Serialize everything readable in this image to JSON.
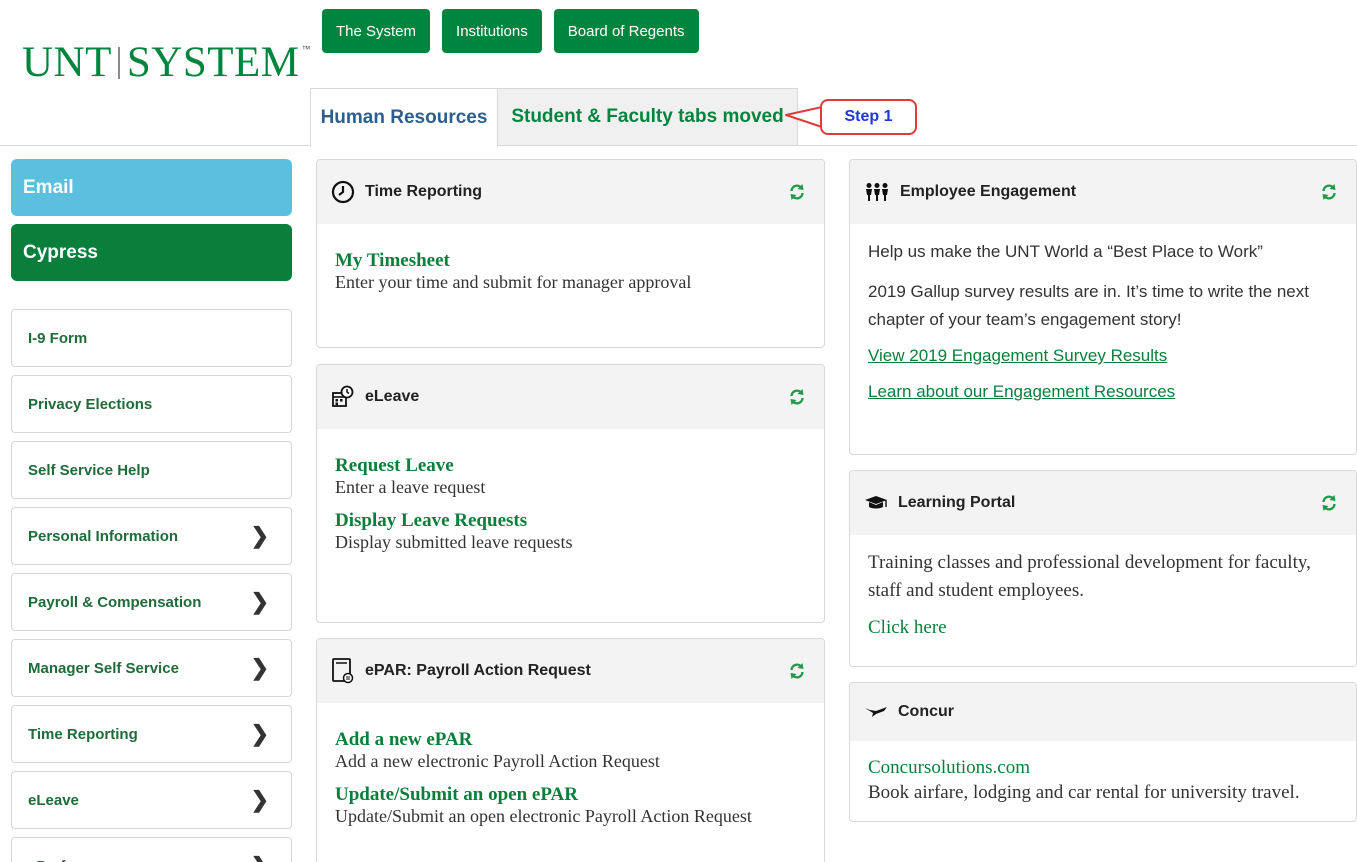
{
  "logo": {
    "left": "UNT",
    "right": "SYSTEM",
    "tm": "™"
  },
  "topnav": [
    "The System",
    "Institutions",
    "Board of Regents"
  ],
  "tabs": {
    "active": "Human Resources",
    "other": "Student & Faculty tabs moved"
  },
  "callout": "Step 1",
  "sidebar": {
    "email": "Email",
    "cypress": "Cypress",
    "items": [
      {
        "label": "I-9 Form",
        "chevron": false
      },
      {
        "label": "Privacy Elections",
        "chevron": false
      },
      {
        "label": "Self Service Help",
        "chevron": false
      },
      {
        "label": "Personal Information",
        "chevron": true
      },
      {
        "label": "Payroll & Compensation",
        "chevron": true
      },
      {
        "label": "Manager Self Service",
        "chevron": true
      },
      {
        "label": "Time Reporting",
        "chevron": true
      },
      {
        "label": "eLeave",
        "chevron": true
      },
      {
        "label": "ePerformance",
        "chevron": true
      }
    ]
  },
  "panels": {
    "time": {
      "title": "Time Reporting",
      "link": "My Timesheet",
      "desc": "Enter your time and submit for manager approval"
    },
    "leave": {
      "title": "eLeave",
      "link1": "Request Leave",
      "desc1": "Enter a leave request",
      "link2": "Display Leave Requests",
      "desc2": "Display submitted leave requests"
    },
    "epar": {
      "title": "ePAR: Payroll Action Request",
      "link1": "Add a new ePAR",
      "desc1": "Add a new electronic Payroll Action Request",
      "link2": "Update/Submit an open ePAR",
      "desc2": "Update/Submit an open electronic Payroll Action Request"
    },
    "engage": {
      "title": "Employee Engagement",
      "text1": "Help us make the UNT World a “Best Place to Work”",
      "text2": "2019 Gallup survey results are in. It’s time to write the next chapter of your team’s engagement story!",
      "link1": "View 2019 Engagement Survey Results",
      "link2": "Learn about our Engagement Resources"
    },
    "learn": {
      "title": "Learning Portal",
      "text": "Training classes and professional development for faculty, staff and student employees.",
      "link": "Click here"
    },
    "concur": {
      "title": "Concur",
      "link": "Concursolutions.com",
      "text": "Book airfare, lodging and car rental for university travel."
    }
  },
  "colors": {
    "green": "#00853e",
    "email": "#5bc0de",
    "callout_border": "#e03a3a",
    "callout_text": "#1a3bd6"
  }
}
